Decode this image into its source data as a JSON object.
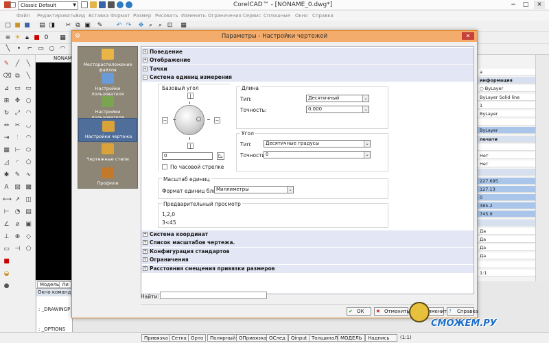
{
  "app": {
    "title": "CorelCAD™ - [NONAME_0.dwg*]",
    "workspace": "Classic Default",
    "drawing_tab": "NONAME",
    "window_controls": [
      "−",
      "□",
      "✕"
    ]
  },
  "menu": [
    "Файл",
    "Редактировать",
    "Вид",
    "Вставка",
    "Формат",
    "Размер",
    "Рисовать",
    "Изменить",
    "Ограничения",
    "Сервис",
    "Сплошные",
    "Окно",
    "Справка"
  ],
  "model_tabs": [
    "Модель",
    "Ли"
  ],
  "command_window": {
    "title": "Окно команд",
    "lines": [
      ": _DRAWINGP",
      ": _OPTIONS"
    ]
  },
  "status_bar": [
    "Привязка",
    "Сетка",
    "Орто",
    "Полярный",
    "ОПривязка",
    "ОСлед",
    "Qinput",
    "ТолщинаЛ",
    "МОДЕЛЬ",
    "Надпись",
    "(1:1)"
  ],
  "properties_panel": {
    "rows": [
      {
        "text": "а",
        "style": "plain"
      },
      {
        "text": "информация",
        "style": "hdr"
      },
      {
        "text": "○ ByLayer",
        "style": "plain"
      },
      {
        "text": "ByLayer    Solid line",
        "style": "plain"
      },
      {
        "text": "1",
        "style": "plain"
      },
      {
        "text": "ByLayer",
        "style": "plain"
      },
      {
        "text": "",
        "style": "plain"
      },
      {
        "text": "ByLayer",
        "style": "sel"
      },
      {
        "text": "печати",
        "style": "hdr"
      },
      {
        "text": "",
        "style": "plain"
      },
      {
        "text": "Нет",
        "style": "plain"
      },
      {
        "text": "Нет",
        "style": "plain"
      },
      {
        "text": "",
        "style": "hdr"
      },
      {
        "text": "227.695",
        "style": "sel"
      },
      {
        "text": "127.13",
        "style": "sel"
      },
      {
        "text": "0",
        "style": "sel"
      },
      {
        "text": "385.2",
        "style": "sel"
      },
      {
        "text": "745.9",
        "style": "sel"
      },
      {
        "text": "",
        "style": "hdr"
      },
      {
        "text": "Да",
        "style": "plain"
      },
      {
        "text": "Да",
        "style": "plain"
      },
      {
        "text": "Да",
        "style": "plain"
      },
      {
        "text": "Да",
        "style": "plain"
      },
      {
        "text": "",
        "style": "plain"
      },
      {
        "text": "1:1",
        "style": "plain"
      }
    ]
  },
  "dialog": {
    "title": "Параметры - Настройки чертежей",
    "categories": [
      {
        "label": "Месторасположение файлов",
        "icon": "folder-icon",
        "active": false
      },
      {
        "label": "Настройки пользователя",
        "icon": "user-settings-icon",
        "active": false
      },
      {
        "label": "Настройки пользователя",
        "icon": "users-icon",
        "active": false
      },
      {
        "label": "Настройки чертежа",
        "icon": "drawing-settings-icon",
        "active": true
      },
      {
        "label": "Чертежные стили",
        "icon": "drafting-styles-icon",
        "active": false
      },
      {
        "label": "Профили",
        "icon": "profiles-icon",
        "active": false
      }
    ],
    "tree_top": [
      {
        "label": "Поведение",
        "sign": "+"
      },
      {
        "label": "Отображение",
        "sign": "+"
      },
      {
        "label": "Точки",
        "sign": "+"
      },
      {
        "label": "Система единиц измерения",
        "sign": "−"
      }
    ],
    "tree_bottom": [
      {
        "label": "Система координат",
        "sign": "+"
      },
      {
        "label": "Список масштабов чертежа.",
        "sign": "+"
      },
      {
        "label": "Конфигурация стандартов",
        "sign": "+"
      },
      {
        "label": "Ограничения",
        "sign": "+"
      },
      {
        "label": "Расстояния смещения привязки размеров",
        "sign": "+"
      }
    ],
    "base_angle": {
      "title": "Базовый угол",
      "value": "0",
      "clockwise_label": "По часовой стрелке",
      "clockwise_checked": false
    },
    "length": {
      "title": "Длина",
      "type_label": "Тип:",
      "type_value": "Десятичный",
      "precision_label": "Точность:",
      "precision_value": "0.000"
    },
    "angle": {
      "title": "Угол",
      "type_label": "Тип:",
      "type_value": "Десятичные градусы",
      "precision_label": "Точность:",
      "precision_value": "0"
    },
    "unit_scale": {
      "title": "Масштаб единиц",
      "label": "Формат единиц блока:",
      "value": "Миллиметры"
    },
    "preview": {
      "title": "Предварительный просмотр",
      "line1": "1,2,0",
      "line2": "3<45"
    },
    "find_label": "Найти:",
    "buttons": {
      "ok": "ОК",
      "cancel": "Отменить",
      "apply": "Применить",
      "help": "Справка"
    }
  },
  "watermark": "СМОЖЕМ.РУ",
  "colors": {
    "dialog_title_bg": "#f3ac6b",
    "active_category": "#506e9a",
    "tree_row_bg": "#e3e6f4",
    "drawing_bg": "#000000"
  }
}
